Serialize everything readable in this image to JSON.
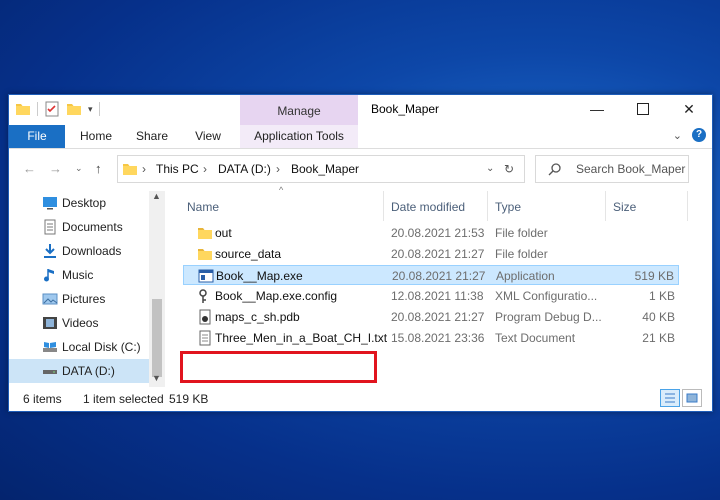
{
  "window": {
    "title": "Book_Maper",
    "context_tab": "Manage",
    "context_ribbon_tab": "Application Tools"
  },
  "ribbon": {
    "tabs": [
      "File",
      "Home",
      "Share",
      "View"
    ]
  },
  "address": {
    "segments": [
      "This PC",
      "DATA (D:)",
      "Book_Maper"
    ],
    "search_placeholder": "Search Book_Maper"
  },
  "nav_pane": {
    "items": [
      {
        "label": "Desktop",
        "icon": "desktop-icon"
      },
      {
        "label": "Documents",
        "icon": "documents-icon"
      },
      {
        "label": "Downloads",
        "icon": "downloads-icon"
      },
      {
        "label": "Music",
        "icon": "music-icon"
      },
      {
        "label": "Pictures",
        "icon": "pictures-icon"
      },
      {
        "label": "Videos",
        "icon": "videos-icon"
      },
      {
        "label": "Local Disk (C:)",
        "icon": "local-disk-icon"
      },
      {
        "label": "DATA (D:)",
        "icon": "drive-icon",
        "selected": true
      }
    ]
  },
  "columns": {
    "name": "Name",
    "date": "Date modified",
    "type": "Type",
    "size": "Size"
  },
  "files": [
    {
      "name": "out",
      "date": "20.08.2021 21:53",
      "type": "File folder",
      "size": "",
      "icon": "folder-icon"
    },
    {
      "name": "source_data",
      "date": "20.08.2021 21:27",
      "type": "File folder",
      "size": "",
      "icon": "folder-icon"
    },
    {
      "name": "Book__Map.exe",
      "date": "20.08.2021 21:27",
      "type": "Application",
      "size": "519 KB",
      "icon": "application-icon",
      "selected": true
    },
    {
      "name": "Book__Map.exe.config",
      "date": "12.08.2021 11:38",
      "type": "XML Configuratio...",
      "size": "1 KB",
      "icon": "config-icon"
    },
    {
      "name": "maps_c_sh.pdb",
      "date": "20.08.2021 21:27",
      "type": "Program Debug D...",
      "size": "40 KB",
      "icon": "pdb-icon"
    },
    {
      "name": "Three_Men_in_a_Boat_CH_I.txt",
      "date": "15.08.2021 23:36",
      "type": "Text Document",
      "size": "21 KB",
      "icon": "text-file-icon"
    }
  ],
  "status": {
    "items_count": "6 items",
    "selection": "1 item selected",
    "selection_size": "519 KB"
  },
  "colors": {
    "accent": "#1a6fc4",
    "selection": "#cce8ff",
    "highlight": "#e1141e",
    "manage_tab": "#e7d5f1"
  }
}
